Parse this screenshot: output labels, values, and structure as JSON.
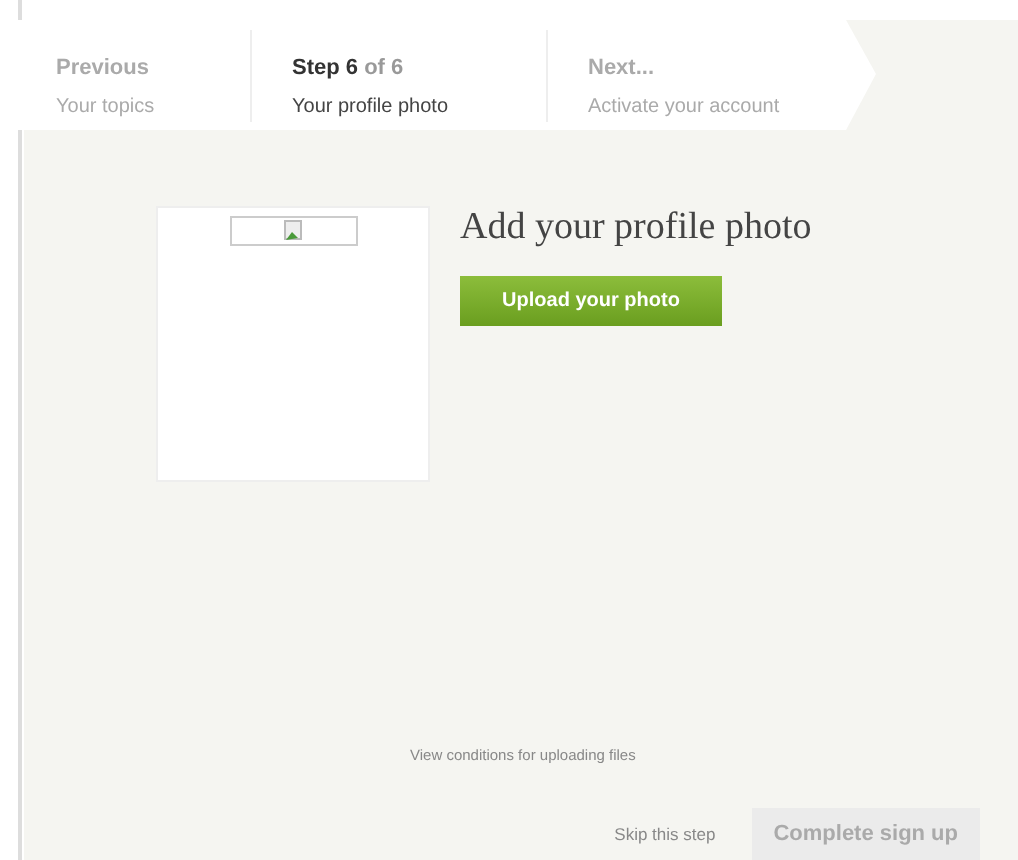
{
  "steps": [
    {
      "title": "Previous",
      "subtitle": "Your topics",
      "selected": false
    },
    {
      "title": "**Step 6** of 6",
      "subtitle": "Your profile photo",
      "selected": true
    },
    {
      "title": "Next...",
      "subtitle": "Activate your account",
      "selected": false
    }
  ],
  "heading": "Add your profile photo",
  "upload_button": "Upload your photo",
  "conditions_link": "View conditions for uploading files",
  "skip_link": "Skip this step",
  "complete_button": {
    "label": "Complete sign up",
    "disabled": true
  }
}
